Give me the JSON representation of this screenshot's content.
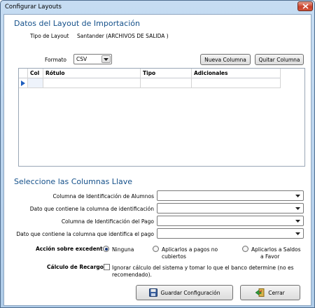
{
  "window": {
    "title": "Configurar Layouts"
  },
  "import_section": {
    "title": "Datos del Layout de Importación",
    "layout_type_label": "Tipo de Layout",
    "layout_type_value": "Santander (ARCHIVOS DE SALIDA )",
    "format_label": "Formato",
    "format_value": "CSV",
    "new_column_button": "Nueva Columna",
    "remove_column_button": "Quitar Columna",
    "grid": {
      "columns": [
        "Col",
        "Rótulo",
        "Tipo",
        "Adicionales"
      ],
      "rows": [
        [
          "",
          "",
          "",
          ""
        ]
      ]
    }
  },
  "key_section": {
    "title": "Seleccione las Columnas Llave",
    "fields": [
      {
        "label": "Columna de Identificación de Alumnos",
        "value": ""
      },
      {
        "label": "Dato que contiene la columna de identificación",
        "value": ""
      },
      {
        "label": "Columna de Identificación del Pago",
        "value": ""
      },
      {
        "label": "Dato que contiene la columna que identifica el pago",
        "value": ""
      }
    ],
    "excess_label": "Acción sobre excedentes",
    "excess_options": [
      {
        "label": "Ninguna",
        "selected": true
      },
      {
        "label_line1": "Aplicarlos a pagos no",
        "label_line2": "cubiertos",
        "selected": false
      },
      {
        "label_line1": "Aplicarlos a Saldos",
        "label_line2": "a Favor",
        "selected": false
      }
    ],
    "surcharge_label": "Cálculo de Recargos",
    "surcharge_checkbox_line1": "Ignorar cálculo del sistema y tomar lo que el banco determine (no es",
    "surcharge_checkbox_line2": "recomendado).",
    "surcharge_checked": false
  },
  "footer": {
    "save_button": "Guardar Configuración",
    "close_button": "Cerrar"
  },
  "colors": {
    "section_title": "#14508a",
    "close_red": "#c7412b",
    "row_indicator": "#1f5fbf"
  }
}
